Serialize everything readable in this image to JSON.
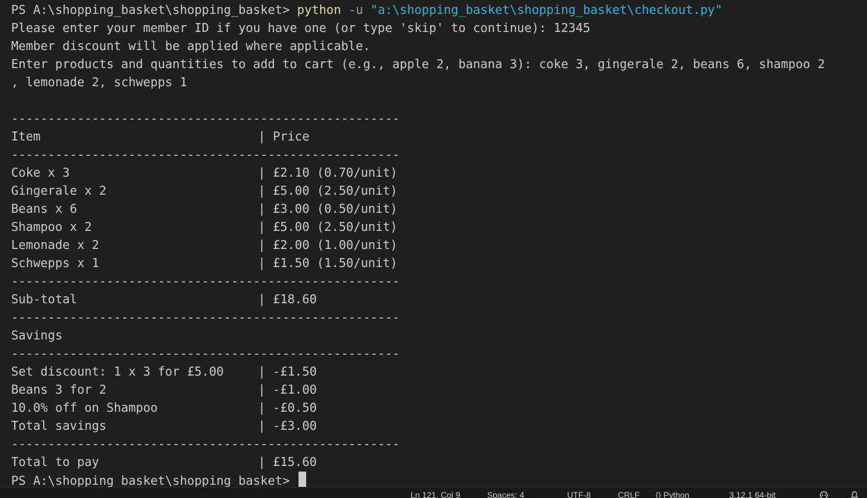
{
  "terminal": {
    "command": {
      "prompt": "PS A:\\shopping_basket\\shopping_basket> ",
      "program": "python",
      "flag": " -u ",
      "script_path": "\"a:\\shopping_basket\\shopping_basket\\checkout.py\""
    },
    "member_prompt": "Please enter your member ID if you have one (or type 'skip' to continue): 12345",
    "discount_msg": "Member discount will be applied where applicable.",
    "products_prompt_1": "Enter products and quantities to add to cart (e.g., apple 2, banana 3): coke 3, gingerale 2, beans 6, shampoo 2",
    "products_prompt_2": ", lemonade 2, schwepps 1",
    "blank": "",
    "separator": "-----------------------------------------------------",
    "header": {
      "item": "Item",
      "price": "Price"
    },
    "items": [
      {
        "name": "Coke x 3",
        "price": "£2.10 (0.70/unit)"
      },
      {
        "name": "Gingerale x 2",
        "price": "£5.00 (2.50/unit)"
      },
      {
        "name": "Beans x 6",
        "price": "£3.00 (0.50/unit)"
      },
      {
        "name": "Shampoo x 2",
        "price": "£5.00 (2.50/unit)"
      },
      {
        "name": "Lemonade x 2",
        "price": "£2.00 (1.00/unit)"
      },
      {
        "name": "Schwepps x 1",
        "price": "£1.50 (1.50/unit)"
      }
    ],
    "subtotal": {
      "label": "Sub-total",
      "value": "£18.60"
    },
    "savings_title": "Savings",
    "savings": [
      {
        "name": "Set discount: 1 x 3 for £5.00",
        "value": "-£1.50"
      },
      {
        "name": "Beans 3 for 2",
        "value": "-£1.00"
      },
      {
        "name": "10.0% off on Shampoo",
        "value": "-£0.50"
      },
      {
        "name": "Total savings",
        "value": "-£3.00"
      }
    ],
    "total": {
      "label": "Total to pay",
      "value": "£15.60"
    },
    "final_prompt": "PS A:\\shopping_basket\\shopping_basket> "
  },
  "statusbar": {
    "position": "Ln 121, Col 9",
    "spaces": "Spaces: 4",
    "encoding": "UTF-8",
    "eol": "CRLF",
    "language": "Python",
    "interpreter": "3.12.1 64-bit"
  },
  "icons": {
    "language_icon": "braces-icon",
    "copilot_icon": "copilot-icon",
    "notification_icon": "bell-icon"
  }
}
